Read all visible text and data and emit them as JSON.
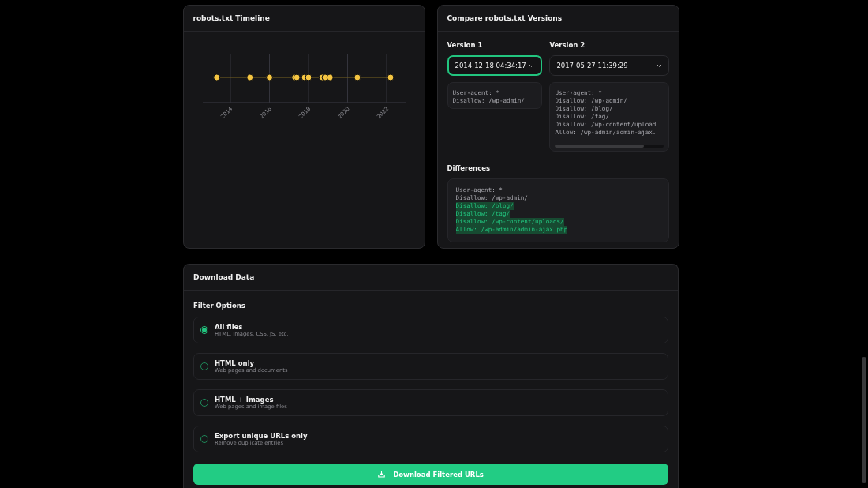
{
  "timeline": {
    "title": "robots.txt Timeline",
    "axis_labels": [
      "2014",
      "2016",
      "2018",
      "2020",
      "2022"
    ]
  },
  "compare": {
    "title": "Compare robots.txt Versions",
    "versions": [
      {
        "label": "Version 1",
        "value": "2014-12-18 04:34:17",
        "focused": true,
        "lines": [
          "User-agent: *",
          "Disallow: /wp-admin/"
        ]
      },
      {
        "label": "Version 2",
        "value": "2017-05-27 11:39:29",
        "focused": false,
        "lines": [
          "User-agent: *",
          "Disallow: /wp-admin/",
          "Disallow: /blog/",
          "Disallow: /tag/",
          "Disallow: /wp-content/upload",
          "Allow: /wp-admin/admin-ajax."
        ]
      }
    ],
    "differences": {
      "title": "Differences",
      "lines": [
        {
          "text": "User-agent: *",
          "added": false
        },
        {
          "text": "Disallow: /wp-admin/",
          "added": false
        },
        {
          "text": "Disallow: /blog/",
          "added": true
        },
        {
          "text": "Disallow: /tag/",
          "added": true
        },
        {
          "text": "Disallow: /wp-content/uploads/",
          "added": true
        },
        {
          "text": "Allow: /wp-admin/admin-ajax.php",
          "added": true
        }
      ]
    }
  },
  "download": {
    "title": "Download Data",
    "filter_title": "Filter Options",
    "options": [
      {
        "label": "All files",
        "description": "HTML, Images, CSS, JS, etc.",
        "selected": true
      },
      {
        "label": "HTML only",
        "description": "Web pages and documents",
        "selected": false
      },
      {
        "label": "HTML + Images",
        "description": "Web pages and image files",
        "selected": false
      },
      {
        "label": "Export unique URLs only",
        "description": "Remove duplicate entries",
        "selected": false
      }
    ],
    "button": "Download Filtered URLs"
  }
}
